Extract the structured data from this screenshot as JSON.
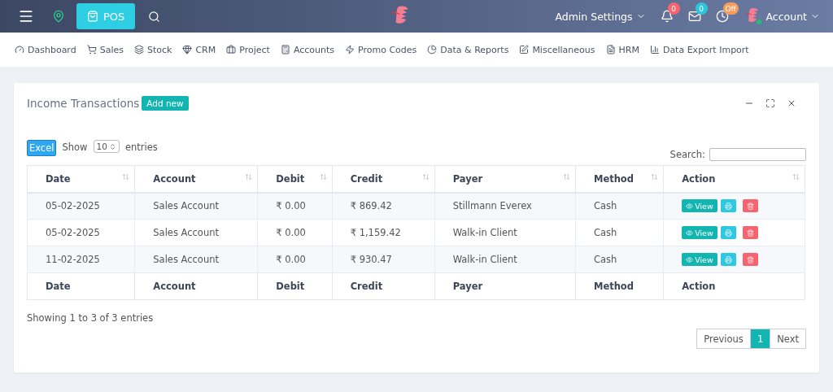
{
  "topbar": {
    "pos_label": "POS",
    "admin_label": "Admin Settings",
    "indicators": [
      {
        "kind": "bell",
        "badge": "0",
        "color": "#f7646f"
      },
      {
        "kind": "mail",
        "badge": "0",
        "color": "#2cc6de"
      },
      {
        "kind": "clock",
        "badge": "Off",
        "color": "#fb9b5a"
      }
    ],
    "account_label": "Account",
    "account_online": true
  },
  "nav": [
    {
      "kind": "gauge",
      "label": "Dashboard"
    },
    {
      "kind": "cart",
      "label": "Sales"
    },
    {
      "kind": "layers",
      "label": "Stock"
    },
    {
      "kind": "gem",
      "label": "CRM"
    },
    {
      "kind": "briefcase",
      "label": "Project"
    },
    {
      "kind": "ledger",
      "label": "Accounts"
    },
    {
      "kind": "zap",
      "label": "Promo Codes"
    },
    {
      "kind": "pie",
      "label": "Data & Reports"
    },
    {
      "kind": "edit",
      "label": "Miscellaneous"
    },
    {
      "kind": "file",
      "label": "HRM"
    },
    {
      "kind": "chart",
      "label": "Data Export Import"
    }
  ],
  "card": {
    "title": "Income Transactions",
    "add_label": "Add new",
    "excel_label": "Excel",
    "show_label": "Show",
    "page_size": "10",
    "entries_label": "entries",
    "search_label": "Search:",
    "columns": [
      "Date",
      "Account",
      "Debit",
      "Credit",
      "Payer",
      "Method",
      "Action"
    ],
    "rows": [
      {
        "cells": [
          "05-02-2025",
          "Sales Account",
          "₹ 0.00",
          "₹ 869.42",
          "Stillmann Everex",
          "Cash"
        ],
        "view_label": "View"
      },
      {
        "cells": [
          "05-02-2025",
          "Sales Account",
          "₹ 0.00",
          "₹ 1,159.42",
          "Walk-in Client",
          "Cash"
        ],
        "view_label": "View"
      },
      {
        "cells": [
          "11-02-2025",
          "Sales Account",
          "₹ 0.00",
          "₹ 930.47",
          "Walk-in Client",
          "Cash"
        ],
        "view_label": "View"
      }
    ],
    "footer_columns": [
      "Date",
      "Account",
      "Debit",
      "Credit",
      "Payer",
      "Method",
      "Action"
    ],
    "info": "Showing 1 to 3 of 3 entries",
    "pages": [
      {
        "label": "Previous",
        "selected": false
      },
      {
        "label": "1",
        "selected": true
      },
      {
        "label": "Next",
        "selected": false
      }
    ]
  }
}
